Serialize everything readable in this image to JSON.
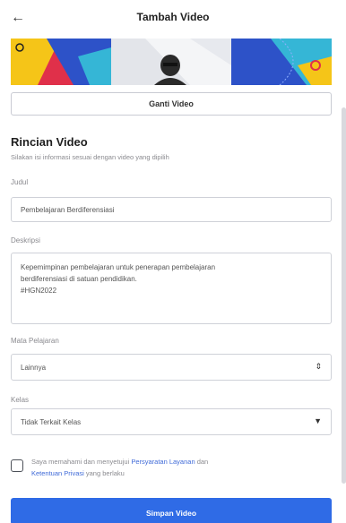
{
  "header": {
    "back_icon": "arrow-left-icon",
    "title": "Tambah Video"
  },
  "video": {
    "change_label": "Ganti Video",
    "thumbnail_colors": [
      "#e0304a",
      "#2d52c8",
      "#f5c518",
      "#35b6d6"
    ]
  },
  "details": {
    "title": "Rincian Video",
    "subtitle": "Silakan isi informasi sesuai dengan video yang dipilih"
  },
  "form": {
    "judul_label": "Judul",
    "judul_value": "Pembelajaran Berdiferensiasi",
    "deskripsi_label": "Deskripsi",
    "deskripsi_value": "Kepemimpinan pembelajaran untuk penerapan pembelajaran\nberdiferensiasi di satuan pendidikan.\n#HGN2022",
    "mapel_label": "Mata Pelajaran",
    "mapel_value": "Lainnya",
    "mapel_icon": "up-down-chevron-icon",
    "kelas_label": "Kelas",
    "kelas_value": "Tidak Terkait Kelas",
    "kelas_icon": "caret-down-icon"
  },
  "agreement": {
    "text_1": "Saya memahami dan menyetujui ",
    "link_1": "Persyaratan Layanan",
    "text_2": " dan ",
    "link_2": "Ketentuan Privasi",
    "text_3": " yang berlaku"
  },
  "submit": {
    "label": "Simpan Video",
    "color": "#2f6be6"
  }
}
